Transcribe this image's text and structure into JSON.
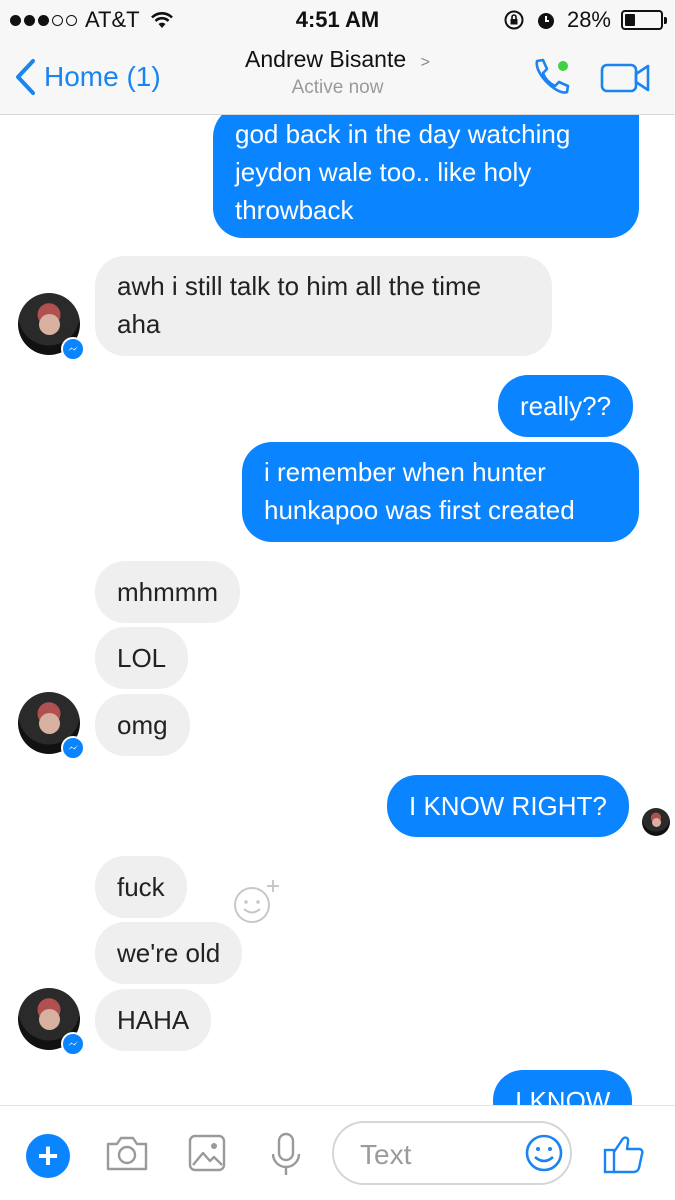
{
  "status_bar": {
    "carrier": "AT&T",
    "time": "4:51 AM",
    "battery": "28%"
  },
  "nav": {
    "back_label": "Home (1)",
    "contact_name": "Andrew Bisante",
    "contact_chevron": ">",
    "contact_status": "Active now"
  },
  "messages": [
    {
      "text_lines": [
        "god back in the day watching",
        "jeydon wale too.. like holy",
        "throwback"
      ],
      "direction": "out"
    },
    {
      "text_lines": [
        "awh i still talk to him all the time",
        "aha"
      ],
      "direction": "in"
    },
    {
      "text": "really??",
      "direction": "out"
    },
    {
      "text_lines": [
        "i remember when hunter",
        "hunkapoo was first created"
      ],
      "direction": "out"
    },
    {
      "text": "mhmmm",
      "direction": "in"
    },
    {
      "text": "LOL",
      "direction": "in"
    },
    {
      "text": "omg",
      "direction": "in"
    },
    {
      "text": "I KNOW RIGHT?",
      "direction": "out"
    },
    {
      "text": "fuck",
      "direction": "in"
    },
    {
      "text": "we're old",
      "direction": "in"
    },
    {
      "text": "HAHA",
      "direction": "in"
    },
    {
      "text": "I KNOW",
      "direction": "out"
    }
  ],
  "composer": {
    "plus_label": "+",
    "placeholder": "Text"
  },
  "colors": {
    "accent": "#0b84ff",
    "incoming_bubble": "#efefef",
    "online_dot": "#3fd13f"
  },
  "icons": [
    "back-chevron-icon",
    "phone-icon",
    "video-camera-icon",
    "messenger-badge-icon",
    "add-reaction-icon",
    "camera-icon",
    "gallery-icon",
    "microphone-icon",
    "emoji-icon",
    "thumbs-up-icon"
  ]
}
